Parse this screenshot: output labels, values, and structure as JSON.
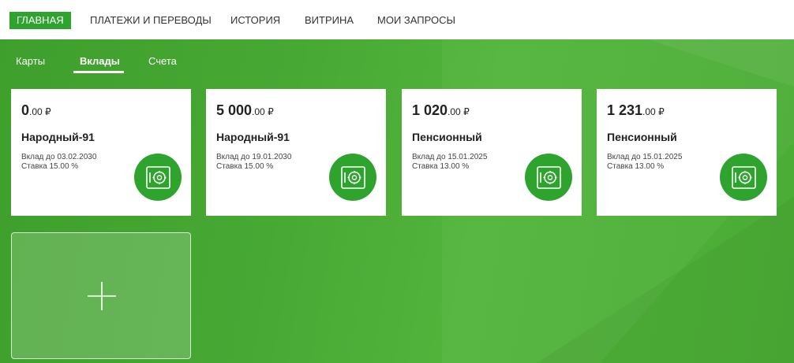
{
  "top_nav": {
    "items": [
      "ГЛАВНАЯ",
      "ПЛАТЕЖИ И ПЕРЕВОДЫ",
      "ИСТОРИЯ",
      "ВИТРИНА",
      "МОИ ЗАПРОСЫ"
    ],
    "active": "ГЛАВНАЯ"
  },
  "sub_tabs": {
    "items": [
      "Карты",
      "Вклады",
      "Счета"
    ],
    "active": "Вклады"
  },
  "deposits": [
    {
      "amount_main": "0",
      "amount_cents": ".00 ₽",
      "name": "Народный-91",
      "until": "Вклад до 03.02.2030",
      "rate": "Ставка 15.00 %",
      "icon": "safe-icon"
    },
    {
      "amount_main": "5 000",
      "amount_cents": ".00 ₽",
      "name": "Народный-91",
      "until": "Вклад до 19.01.2030",
      "rate": "Ставка 15.00 %",
      "icon": "safe-icon"
    },
    {
      "amount_main": "1 020",
      "amount_cents": ".00 ₽",
      "name": "Пенсионный",
      "until": "Вклад до 15.01.2025",
      "rate": "Ставка 13.00 %",
      "icon": "safe-icon"
    },
    {
      "amount_main": "1 231",
      "amount_cents": ".00 ₽",
      "name": "Пенсионный",
      "until": "Вклад до 15.01.2025",
      "rate": "Ставка 13.00 %",
      "icon": "safe-icon"
    }
  ],
  "add_tile": {
    "icon": "plus-icon"
  },
  "colors": {
    "brand_green": "#2ea42e",
    "background_green": "#4aab35",
    "card_bg": "#ffffff"
  }
}
